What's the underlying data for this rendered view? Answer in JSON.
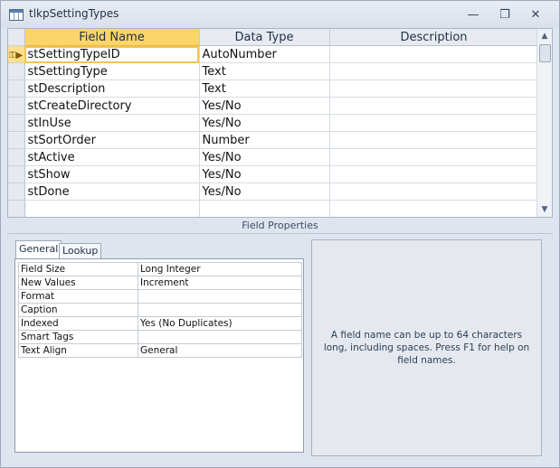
{
  "window": {
    "title": "tlkpSettingTypes"
  },
  "grid": {
    "headers": {
      "field_name": "Field Name",
      "data_type": "Data Type",
      "description": "Description"
    },
    "rows": [
      {
        "field_name": "stSettingTypeID",
        "data_type": "AutoNumber",
        "description": ""
      },
      {
        "field_name": "stSettingType",
        "data_type": "Text",
        "description": ""
      },
      {
        "field_name": "stDescription",
        "data_type": "Text",
        "description": ""
      },
      {
        "field_name": "stCreateDirectory",
        "data_type": "Yes/No",
        "description": ""
      },
      {
        "field_name": "stInUse",
        "data_type": "Yes/No",
        "description": ""
      },
      {
        "field_name": "stSortOrder",
        "data_type": "Number",
        "description": ""
      },
      {
        "field_name": "stActive",
        "data_type": "Yes/No",
        "description": ""
      },
      {
        "field_name": "stShow",
        "data_type": "Yes/No",
        "description": ""
      },
      {
        "field_name": "stDone",
        "data_type": "Yes/No",
        "description": ""
      },
      {
        "field_name": "",
        "data_type": "",
        "description": ""
      }
    ]
  },
  "field_properties": {
    "label": "Field Properties",
    "tabs": {
      "general": "General",
      "lookup": "Lookup"
    },
    "props": [
      {
        "name": "Field Size",
        "value": "Long Integer"
      },
      {
        "name": "New Values",
        "value": "Increment"
      },
      {
        "name": "Format",
        "value": ""
      },
      {
        "name": "Caption",
        "value": ""
      },
      {
        "name": "Indexed",
        "value": "Yes (No Duplicates)"
      },
      {
        "name": "Smart Tags",
        "value": ""
      },
      {
        "name": "Text Align",
        "value": "General"
      }
    ],
    "help_text": "A field name can be up to 64 characters long, including spaces. Press F1 for help on field names."
  },
  "colors": {
    "selected_header": "#fbd56a",
    "window_bg": "#dfe5ee"
  },
  "icons": {
    "window": "table-icon",
    "primary_key": "key-icon"
  }
}
